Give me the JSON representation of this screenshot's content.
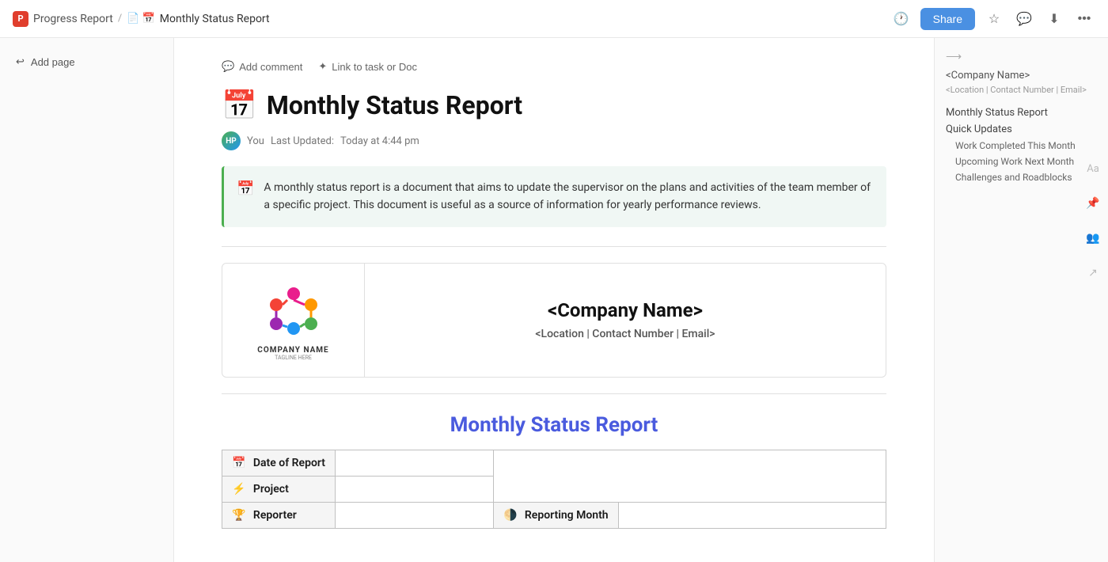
{
  "topbar": {
    "app_name": "Progress Report",
    "breadcrumb_sep": "/",
    "doc_icon": "📅",
    "doc_name": "Monthly Status Report",
    "share_label": "Share"
  },
  "sidebar_left": {
    "add_page_label": "Add page"
  },
  "doc": {
    "title_icon": "📅",
    "title": "Monthly Status Report",
    "meta_user": "You",
    "meta_updated": "Last Updated:",
    "meta_time": "Today at 4:44 pm",
    "callout_icon": "📅",
    "callout_text": "A monthly status report is a document that aims to update the supervisor on the plans and activities of the team member of a specific project. This document is useful as a source of information for yearly performance reviews.",
    "company_name_placeholder": "<Company Name>",
    "company_details_placeholder": "<Location | Contact Number | Email>",
    "company_logo_name": "COMPANY NAME",
    "company_logo_tagline": "TAGLINE HERE",
    "section_title": "Monthly Status Report",
    "table": {
      "rows": [
        {
          "icon": "📅",
          "label": "Date of Report",
          "value": ""
        },
        {
          "icon": "⚡",
          "label": "Project",
          "value": ""
        },
        {
          "icon": "🏆",
          "label": "Reporter",
          "value": "",
          "has_right_cell": true,
          "right_icon": "🌗",
          "right_label": "Reporting Month",
          "right_value": ""
        }
      ]
    }
  },
  "sidebar_right": {
    "company_name": "<Company Name>",
    "location": "<Location | Contact Number | Email>",
    "nav_items": [
      {
        "label": "Monthly Status Report",
        "sub": false
      },
      {
        "label": "Quick Updates",
        "sub": false
      },
      {
        "label": "Work Completed This Month",
        "sub": true
      },
      {
        "label": "Upcoming Work Next Month",
        "sub": true
      },
      {
        "label": "Challenges and Roadblocks",
        "sub": true
      }
    ]
  },
  "actions": {
    "add_comment": "Add comment",
    "link_task": "Link to task or Doc"
  }
}
